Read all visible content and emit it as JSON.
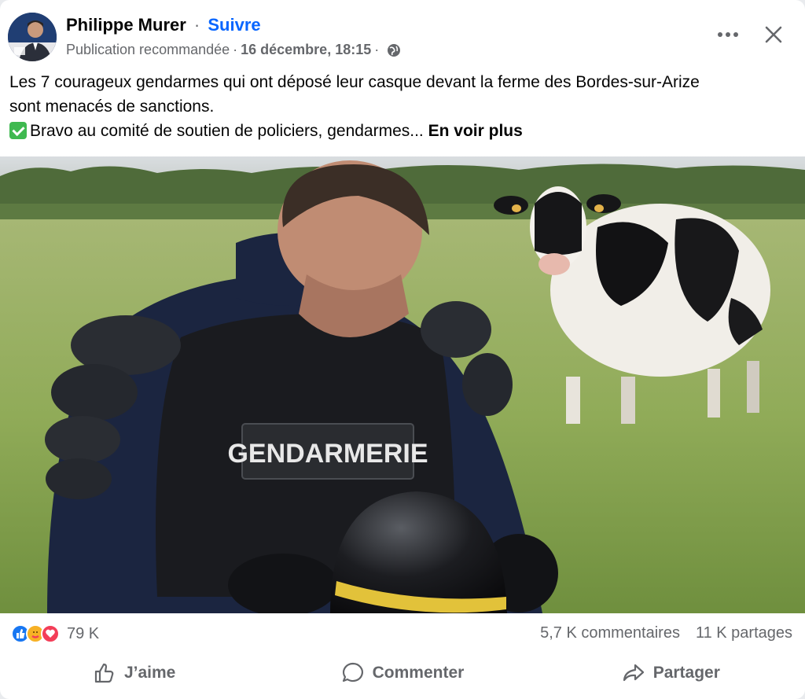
{
  "author": {
    "name": "Philippe Murer",
    "separator": "·",
    "follow_label": "Suivre"
  },
  "meta": {
    "label": "Publication recommandée",
    "separator": "·",
    "date": "16 décembre, 18:15",
    "separator2": "·",
    "audience_icon": "globe-icon"
  },
  "header_actions": {
    "more_icon": "more-options-icon",
    "close_icon": "close-icon"
  },
  "post": {
    "line1": "Les 7 courageux gendarmes qui ont déposé leur casque devant la ferme des Bordes-sur-Arize",
    "line2": "sont menacés de sanctions.",
    "line3": "Bravo au comité de soutien de policiers, gendarmes...",
    "see_more": "En voir plus"
  },
  "photo": {
    "vest_text": "GENDARMERIE"
  },
  "stats": {
    "reaction_icons": [
      "like-icon",
      "care-icon",
      "love-icon"
    ],
    "reactions_count": "79 K",
    "comments": "5,7 K commentaires",
    "shares": "11 K partages"
  },
  "actions": {
    "like": "J’aime",
    "comment": "Commenter",
    "share": "Partager"
  },
  "colors": {
    "accent": "#0866ff",
    "secondary_text": "#65676b",
    "primary_text": "#050505"
  }
}
